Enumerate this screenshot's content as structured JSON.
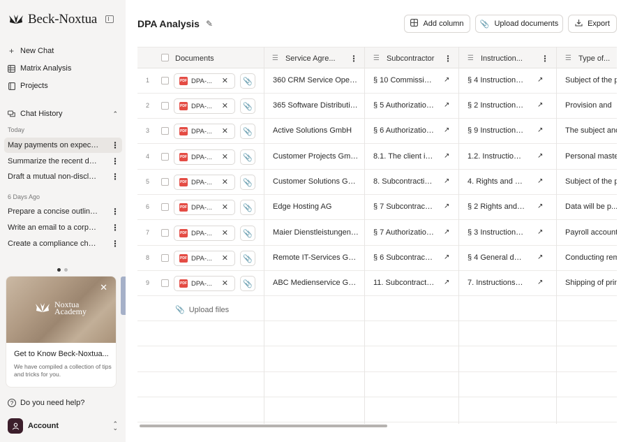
{
  "brand": {
    "name": "Beck-Noxtua"
  },
  "nav": [
    {
      "label": "New Chat",
      "icon": "plus-icon"
    },
    {
      "label": "Matrix Analysis",
      "icon": "table-icon"
    },
    {
      "label": "Projects",
      "icon": "book-icon"
    }
  ],
  "history": {
    "label": "Chat History",
    "today_label": "Today",
    "today": [
      "May payments on expecte...",
      "Summarize the recent deci...",
      "Draft a mutual non-disclos..."
    ],
    "older_label": "6 Days Ago",
    "older": [
      "Prepare a concise outline f...",
      "Write an email to a corpora...",
      "Create a compliance chec..."
    ]
  },
  "promo": {
    "logo_line1": "Noxtua",
    "logo_line2": "Academy",
    "title": "Get to Know Beck-Noxtua...",
    "desc": "We have compiled a collection of tips and tricks for you.",
    "slide": 1,
    "slides": 2
  },
  "help_label": "Do you need help?",
  "account_label": "Account",
  "main": {
    "title": "DPA Analysis",
    "buttons": {
      "add_column": "Add column",
      "upload_documents": "Upload documents",
      "export": "Export"
    },
    "columns": [
      "Documents",
      "Service Agre...",
      "Subcontractor",
      "Instruction...",
      "Type of..."
    ],
    "file_label": "DPA-...",
    "upload_files": "Upload files",
    "rows": [
      {
        "n": "1",
        "service": "360 CRM Service Operat...",
        "sub": "§ 10 Commissioni...",
        "instr": "§ 4 Instruction a...",
        "type": "Subject of the pr"
      },
      {
        "n": "2",
        "service": "365 Software Distributio...",
        "sub": "§ 5 Authorization f...",
        "instr": "§ 2 Instructions...",
        "type": "Provision and"
      },
      {
        "n": "3",
        "service": "Active Solutions GmbH",
        "sub": "§ 6 Authorization f...",
        "instr": "§ 9 Instructions...",
        "type": "The subject and"
      },
      {
        "n": "4",
        "service": "Customer Projects GmbH",
        "sub": "8.1. The client is...",
        "instr": "1.2. Instruction: D...",
        "type": "Personal master"
      },
      {
        "n": "5",
        "service": "Customer Solutions Gmb...",
        "sub": "8. Subcontracting...",
        "instr": "4. Rights and dut...",
        "type": "Subject of the pr"
      },
      {
        "n": "6",
        "service": "Edge Hosting AG",
        "sub": "§ 7 Subcontractin...",
        "instr": "§ 2 Rights and d...",
        "type": "Data will be p..."
      },
      {
        "n": "7",
        "service": "Maier Dienstleistungen G...",
        "sub": "§ 7 Authorization f...",
        "instr": "§ 3 Instructions...",
        "type": "Payroll accountin"
      },
      {
        "n": "8",
        "service": "Remote IT-Services Gmb...",
        "sub": "§ 6 Subcontractor...",
        "instr": "§ 4 General duti...",
        "type": "Conducting rem"
      },
      {
        "n": "9",
        "service": "ABC Medienservice Gmbh",
        "sub": "11. Subcontracting...",
        "instr": "7. Instructions of...",
        "type": "Shipping of print"
      }
    ]
  }
}
